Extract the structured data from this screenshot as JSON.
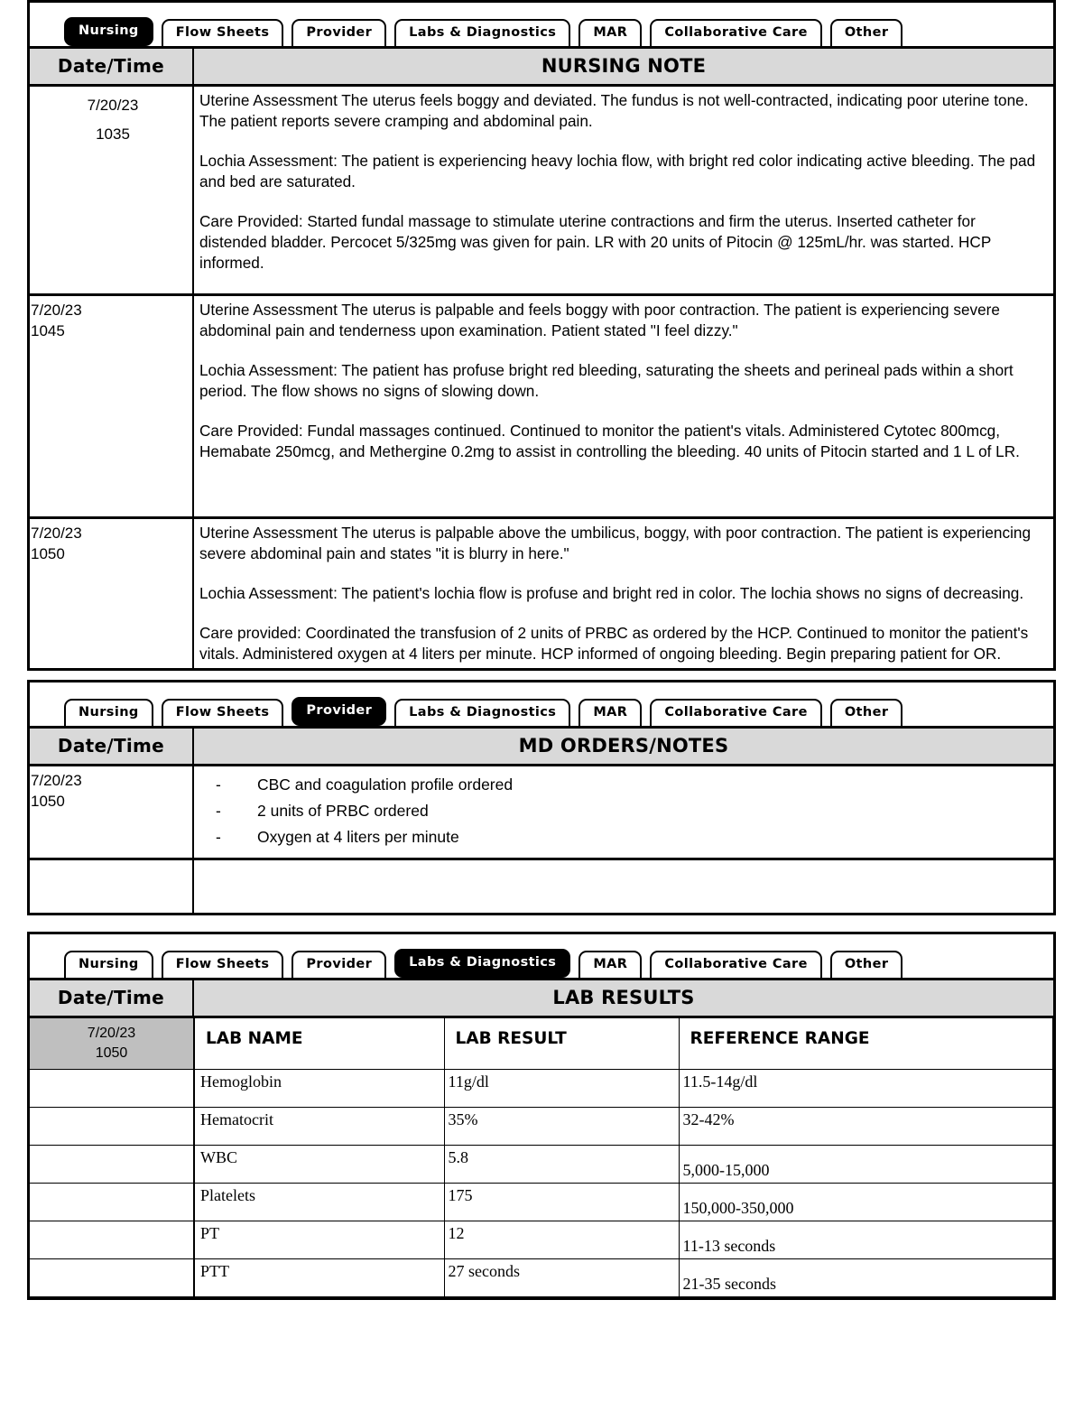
{
  "tabs": [
    "Nursing",
    "Flow Sheets",
    "Provider",
    "Labs & Diagnostics",
    "MAR",
    "Collaborative Care",
    "Other"
  ],
  "sections": {
    "nursing": {
      "active_tab": "Nursing",
      "date_header": "Date/Time",
      "title": "NURSING NOTE",
      "entries": [
        {
          "date": "7/20/23",
          "time": "1035",
          "paragraphs": [
            "Uterine Assessment  The uterus feels boggy and deviated. The fundus is not well-contracted, indicating poor uterine tone. The patient reports severe cramping and abdominal pain.",
            "Lochia Assessment: The patient is experiencing heavy lochia flow, with bright red color indicating active bleeding. The pad and bed are saturated.",
            "Care Provided: Started fundal massage to stimulate uterine contractions and firm the uterus. Inserted catheter for distended bladder. Percocet 5/325mg was given for pain. LR with 20 units of Pitocin @ 125mL/hr. was started. HCP informed."
          ]
        },
        {
          "date": "7/20/23",
          "time": "1045",
          "paragraphs": [
            "Uterine Assessment  The uterus is palpable and feels boggy with poor contraction. The patient is experiencing severe abdominal pain and tenderness upon examination. Patient stated \"I feel dizzy.\"",
            "Lochia Assessment: The patient has profuse bright red bleeding, saturating the sheets and perineal pads within a short period. The flow shows no signs of slowing down.",
            "Care Provided: Fundal massages continued. Continued to monitor the patient's vitals. Administered Cytotec 800mcg, Hemabate 250mcg, and Methergine 0.2mg to assist in controlling the bleeding. 40 units of Pitocin started and 1 L of LR."
          ]
        },
        {
          "date": "7/20/23",
          "time": "1050",
          "paragraphs": [
            "Uterine Assessment  The uterus is palpable above the umbilicus, boggy, with poor contraction. The patient is experiencing severe abdominal pain and states \"it is blurry in here.\"",
            "Lochia Assessment: The patient's lochia flow is profuse and bright red in color. The lochia shows no signs of decreasing.",
            "Care provided: Coordinated the transfusion of 2 units of PRBC as ordered by the HCP. Continued to monitor the patient's vitals. Administered oxygen at 4 liters per minute. HCP informed of ongoing bleeding. Begin preparing patient for OR."
          ]
        }
      ]
    },
    "provider": {
      "active_tab": "Provider",
      "date_header": "Date/Time",
      "title": "MD ORDERS/NOTES",
      "date": "7/20/23",
      "time": "1050",
      "dash": "-",
      "orders": [
        "CBC and coagulation profile ordered",
        "2 units of PRBC ordered",
        "Oxygen at 4 liters per minute"
      ]
    },
    "labs": {
      "active_tab": "Labs & Diagnostics",
      "date_header": "Date/Time",
      "title": "LAB RESULTS",
      "date": "7/20/23",
      "time": "1050",
      "columns": [
        "LAB NAME",
        "LAB RESULT",
        "REFERENCE RANGE"
      ],
      "rows": [
        {
          "name": "Hemoglobin",
          "result": "11g/dl",
          "range": "11.5-14g/dl",
          "range_align": "top"
        },
        {
          "name": "Hematocrit",
          "result": "35%",
          "range": "32-42%",
          "range_align": "top"
        },
        {
          "name": "WBC",
          "result": "5.8",
          "range": "5,000-15,000",
          "range_align": "bottom"
        },
        {
          "name": "Platelets",
          "result": "175",
          "range": "150,000-350,000",
          "range_align": "bottom"
        },
        {
          "name": "PT",
          "result": "12",
          "range": "11-13 seconds",
          "range_align": "bottom"
        },
        {
          "name": "PTT",
          "result": "27 seconds",
          "range": "21-35 seconds",
          "range_align": "bottom"
        }
      ]
    }
  },
  "colors": {
    "header_gray": "#d9d9d9",
    "date_gray": "#bfbfbf",
    "active_tab_bg": "#000000",
    "border": "#000000"
  }
}
